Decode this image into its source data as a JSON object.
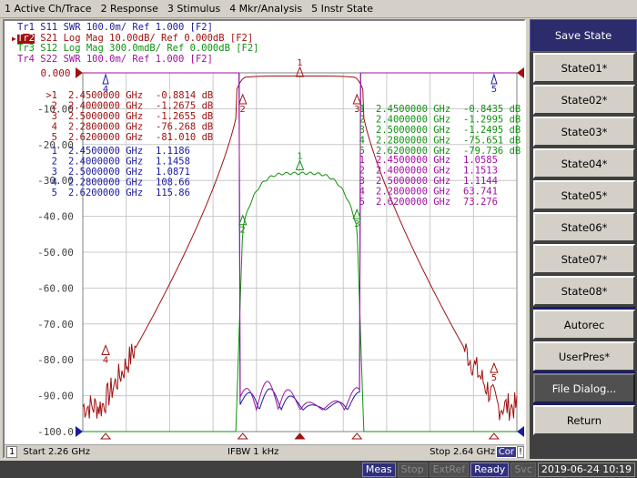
{
  "menu": [
    "1 Active Ch/Trace",
    "2 Response",
    "3 Stimulus",
    "4 Mkr/Analysis",
    "5 Instr State"
  ],
  "traces": [
    {
      "id": "Tr1",
      "param": "S11",
      "format": "SWR",
      "scale": "100.0m/",
      "ref": "Ref 1.000",
      "tag": "[F2]",
      "color": "#1a1aa0",
      "active": false
    },
    {
      "id": "Tr2",
      "param": "S21",
      "format": "Log Mag",
      "scale": "10.00dB/",
      "ref": "Ref 0.000dB",
      "tag": "[F2]",
      "color": "#a01010",
      "active": true
    },
    {
      "id": "Tr3",
      "param": "S12",
      "format": "Log Mag",
      "scale": "300.0mdB/",
      "ref": "Ref 0.000dB",
      "tag": "[F2]",
      "color": "#109010",
      "active": false
    },
    {
      "id": "Tr4",
      "param": "S22",
      "format": "SWR",
      "scale": "100.0m/",
      "ref": "Ref 1.000",
      "tag": "[F2]",
      "color": "#a010a0",
      "active": false
    }
  ],
  "yaxis": {
    "labels": [
      "0.000",
      "-10.00",
      "-20.00",
      "-30.00",
      "-40.00",
      "-50.00",
      "-60.00",
      "-70.00",
      "-80.00",
      "-90.00",
      "-100.0"
    ]
  },
  "marker_tables": {
    "tr2": {
      "color": "#a01010",
      "rows": [
        {
          "n": ">1",
          "freq": "2.4500000 GHz",
          "val": "-0.8814 dB"
        },
        {
          "n": "2",
          "freq": "2.4000000 GHz",
          "val": "-1.2675 dB"
        },
        {
          "n": "3",
          "freq": "2.5000000 GHz",
          "val": "-1.2655 dB"
        },
        {
          "n": "4",
          "freq": "2.2800000 GHz",
          "val": "-76.268 dB"
        },
        {
          "n": "5",
          "freq": "2.6200000 GHz",
          "val": "-81.010 dB"
        }
      ]
    },
    "tr1": {
      "color": "#1a1aa0",
      "rows": [
        {
          "n": "1",
          "freq": "2.4500000 GHz",
          "val": "1.1186"
        },
        {
          "n": "2",
          "freq": "2.4000000 GHz",
          "val": "1.1458"
        },
        {
          "n": "3",
          "freq": "2.5000000 GHz",
          "val": "1.0871"
        },
        {
          "n": "4",
          "freq": "2.2800000 GHz",
          "val": "108.66"
        },
        {
          "n": "5",
          "freq": "2.6200000 GHz",
          "val": "115.86"
        }
      ]
    },
    "tr3": {
      "color": "#109010",
      "rows": [
        {
          "n": "1",
          "freq": "2.4500000 GHz",
          "val": "-0.8435 dB"
        },
        {
          "n": "2",
          "freq": "2.4000000 GHz",
          "val": "-1.2995 dB"
        },
        {
          "n": "3",
          "freq": "2.5000000 GHz",
          "val": "-1.2495 dB"
        },
        {
          "n": "4",
          "freq": "2.2800000 GHz",
          "val": "-75.651 dB"
        },
        {
          "n": "5",
          "freq": "2.6200000 GHz",
          "val": "-79.736 dB"
        }
      ]
    },
    "tr4": {
      "color": "#a010a0",
      "rows": [
        {
          "n": "1",
          "freq": "2.4500000 GHz",
          "val": "1.0585"
        },
        {
          "n": "2",
          "freq": "2.4000000 GHz",
          "val": "1.1513"
        },
        {
          "n": "3",
          "freq": "2.5000000 GHz",
          "val": "1.1144"
        },
        {
          "n": "4",
          "freq": "2.2800000 GHz",
          "val": "63.741"
        },
        {
          "n": "5",
          "freq": "2.6200000 GHz",
          "val": "73.276"
        }
      ]
    }
  },
  "chart_data": {
    "type": "line",
    "x_range_ghz": [
      2.26,
      2.64
    ],
    "y_range_db": [
      -100,
      0
    ],
    "grid": true,
    "marker_freqs_ghz": [
      2.45,
      2.4,
      2.5,
      2.28,
      2.62
    ],
    "marker_labels": [
      "1",
      "2",
      "3",
      "4",
      "5"
    ]
  },
  "status": {
    "channel": "1",
    "start": "Start 2.26 GHz",
    "ifbw": "IFBW 1 kHz",
    "stop": "Stop 2.64 GHz",
    "cor": "Cor",
    "excl": "!"
  },
  "softkeys": {
    "title": "Save State",
    "items": [
      "State01*",
      "State02*",
      "State03*",
      "State04*",
      "State05*",
      "State06*",
      "State07*",
      "State08*",
      "Autorec",
      "UserPres*",
      "File Dialog...",
      "Return"
    ]
  },
  "bottom": {
    "meas": "Meas",
    "stop": "Stop",
    "extref": "ExtRef",
    "ready": "Ready",
    "svc": "Svc",
    "datetime": "2019-06-24 10:19"
  }
}
